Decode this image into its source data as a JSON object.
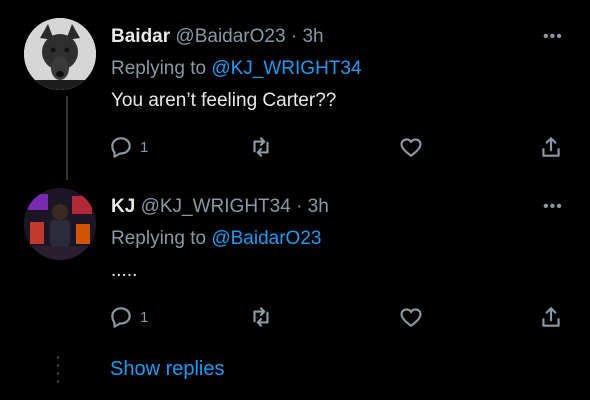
{
  "tweets": [
    {
      "name": "Baidar",
      "handle": "@BaidarO23",
      "time": "3h",
      "replying_prefix": "Replying to",
      "replying_to": "@KJ_WRIGHT34",
      "text": "You aren’t feeling Carter??",
      "reply_count": "1",
      "more": "•••"
    },
    {
      "name": "KJ",
      "handle": "@KJ_WRIGHT34",
      "time": "3h",
      "replying_prefix": "Replying to",
      "replying_to": "@BaidarO23",
      "text": ".....",
      "reply_count": "1",
      "more": "•••"
    }
  ],
  "separator": "·",
  "show_replies": "Show replies",
  "icons": [
    "reply-icon",
    "retweet-icon",
    "like-icon",
    "share-icon",
    "more-icon"
  ],
  "colors": {
    "background": "#000000",
    "text": "#e7e9ea",
    "secondary": "#8b98a5",
    "accent": "#1d9bf0"
  }
}
